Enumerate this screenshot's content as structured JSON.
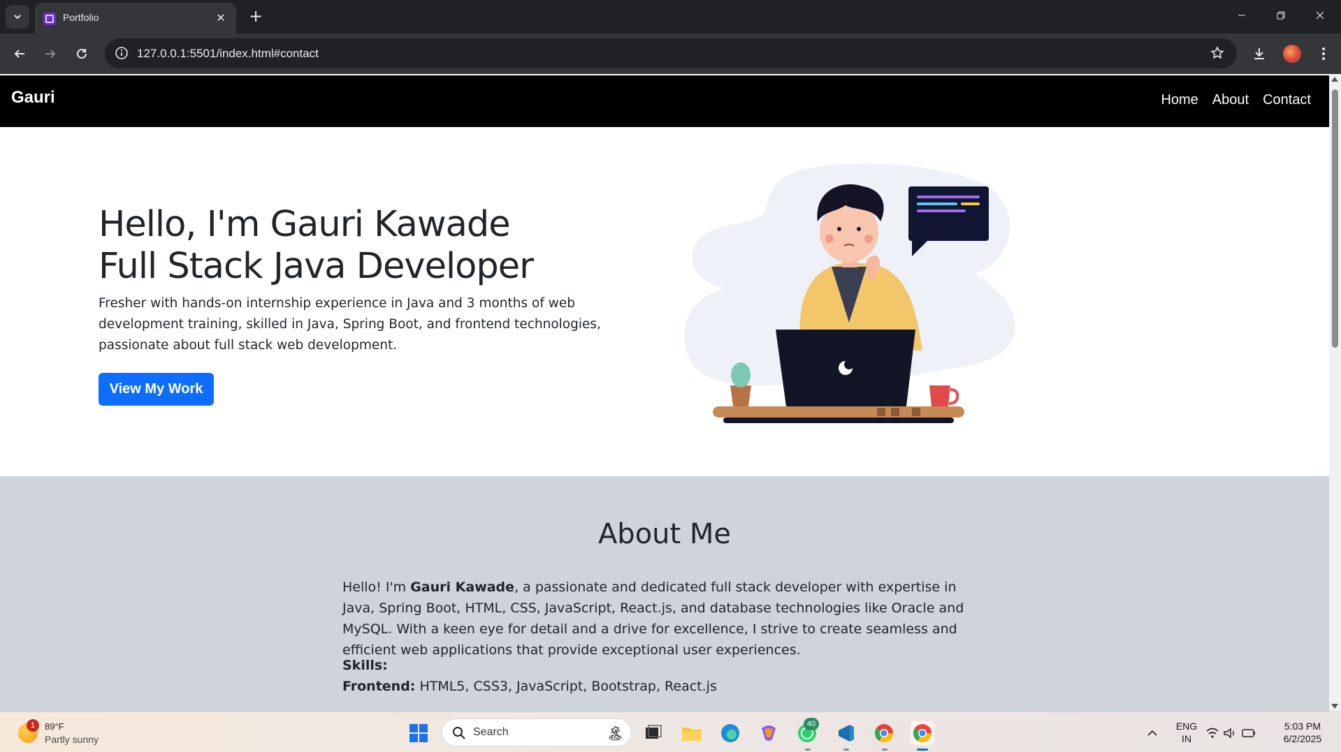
{
  "browser": {
    "tab_title": "Portfolio",
    "url": "127.0.0.1:5501/index.html#contact"
  },
  "navbar": {
    "brand": "Gauri",
    "links": [
      "Home",
      "About",
      "Contact"
    ]
  },
  "hero": {
    "title_line1": "Hello, I'm Gauri Kawade",
    "title_line2": "Full Stack Java Developer",
    "description": "Fresher with hands-on internship experience in Java and 3 months of web development training, skilled in Java, Spring Boot, and frontend technologies, passionate about full stack web development.",
    "button_label": "View My Work"
  },
  "about": {
    "title": "About Me",
    "intro_prefix": "Hello! I'm ",
    "name": "Gauri Kawade",
    "intro_suffix": ", a passionate and dedicated full stack developer with expertise in Java, Spring Boot, HTML, CSS, JavaScript, React.js, and database technologies like Oracle and MySQL. With a keen eye for detail and a drive for excellence, I strive to create seamless and efficient web applications that provide exceptional user experiences.",
    "skills_heading": "Skills:",
    "frontend_label": "Frontend:",
    "frontend_value": " HTML5, CSS3, JavaScript, Bootstrap, React.js"
  },
  "taskbar": {
    "weather_badge": "1",
    "weather_temp": "89°F",
    "weather_condition": "Partly sunny",
    "search_placeholder": "Search",
    "whatsapp_badge": "40",
    "lang_line1": "ENG",
    "lang_line2": "IN",
    "time": "5:03 PM",
    "date": "6/2/2025"
  },
  "colors": {
    "navbar_bg": "#000000",
    "primary_button": "#0d6efd",
    "about_bg": "#cfd3da",
    "browser_frame": "#202124"
  }
}
